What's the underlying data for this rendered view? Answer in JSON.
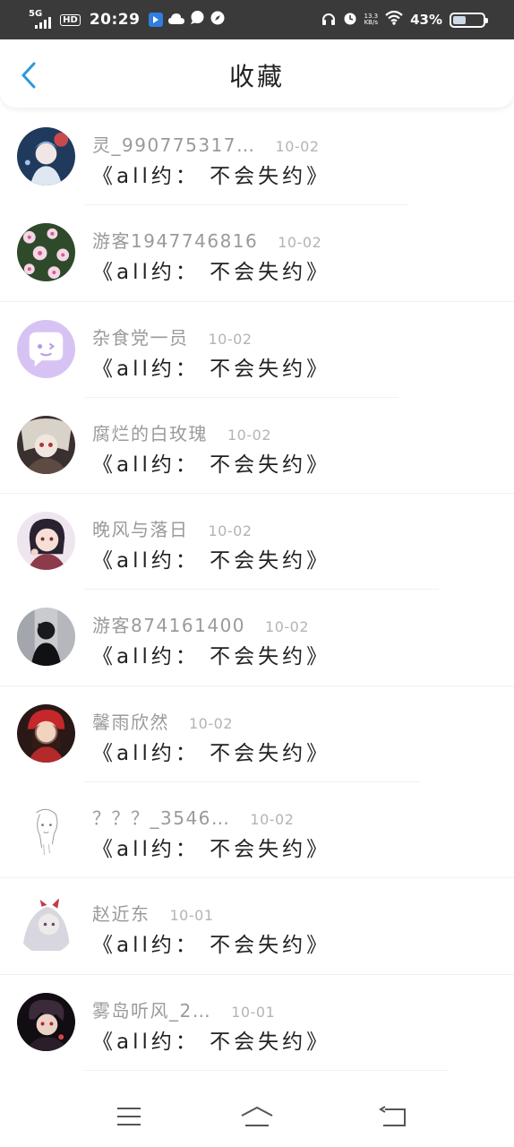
{
  "status_bar": {
    "network": "5G",
    "hd": "HD",
    "time": "20:29",
    "net_speed_value": "13.3",
    "net_speed_unit": "KB/s",
    "battery_percent": "43%",
    "battery_level": 0.43,
    "icons": [
      "signal-icon",
      "hd-icon",
      "app-notify-icon",
      "cloud-icon",
      "chat-icon",
      "compass-icon",
      "headphones-icon",
      "alarm-icon",
      "wifi-icon",
      "battery-icon"
    ]
  },
  "header": {
    "title": "收藏",
    "back_icon": "chevron-left-icon",
    "accent_color": "#2a9ad8"
  },
  "items": [
    {
      "name": "灵_990775317…",
      "date": "10-02",
      "title": "《all约： 不会失约》",
      "avatar": "anime-character-avatar"
    },
    {
      "name": "游客1947746816",
      "date": "10-02",
      "title": "《all约： 不会失约》",
      "avatar": "pink-flowers-avatar"
    },
    {
      "name": "杂食党一员",
      "date": "10-02",
      "title": "《all约： 不会失约》",
      "avatar": "default-chat-avatar"
    },
    {
      "name": "腐烂的白玫瑰",
      "date": "10-02",
      "title": "《all约： 不会失约》",
      "avatar": "anime-character-avatar"
    },
    {
      "name": "晚风与落日",
      "date": "10-02",
      "title": "《all约： 不会失约》",
      "avatar": "anime-character-avatar"
    },
    {
      "name": "游客874161400",
      "date": "10-02",
      "title": "《all约： 不会失约》",
      "avatar": "photo-avatar"
    },
    {
      "name": "馨雨欣然",
      "date": "10-02",
      "title": "《all约： 不会失约》",
      "avatar": "anime-character-avatar"
    },
    {
      "name": "？？？_3546…",
      "date": "10-02",
      "title": "《all约： 不会失约》",
      "avatar": "sketch-avatar"
    },
    {
      "name": "赵近东",
      "date": "10-01",
      "title": "《all约： 不会失约》",
      "avatar": "anime-character-avatar"
    },
    {
      "name": "雾岛听风_2…",
      "date": "10-01",
      "title": "《all约： 不会失约》",
      "avatar": "anime-character-avatar"
    }
  ],
  "nav_bar": {
    "icons": [
      "menu-icon",
      "home-icon",
      "back-icon"
    ]
  }
}
